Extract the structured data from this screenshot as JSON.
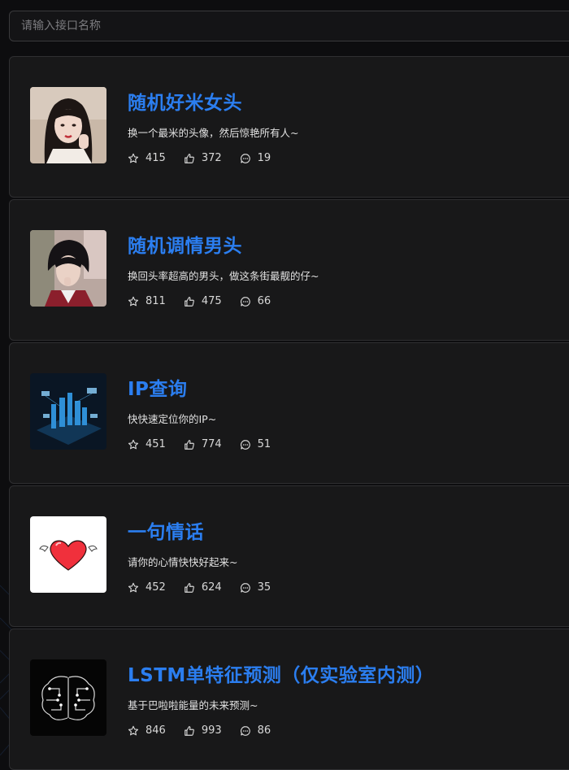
{
  "search": {
    "placeholder": "请输入接口名称"
  },
  "cards": [
    {
      "title": "随机好米女头",
      "description": "换一个最米的头像，然后惊艳所有人~",
      "stars": "415",
      "likes": "372",
      "comments": "19",
      "thumbnail": "girl-portrait"
    },
    {
      "title": "随机调情男头",
      "description": "换回头率超高的男头，做这条街最靓的仔~",
      "stars": "811",
      "likes": "475",
      "comments": "66",
      "thumbnail": "boy-portrait"
    },
    {
      "title": "IP查询",
      "description": "快快速定位你的IP~",
      "stars": "451",
      "likes": "774",
      "comments": "51",
      "thumbnail": "city-network"
    },
    {
      "title": "一句情话",
      "description": "请你的心情快快好起来~",
      "stars": "452",
      "likes": "624",
      "comments": "35",
      "thumbnail": "winged-heart"
    },
    {
      "title": "LSTM单特征预测（仅实验室内测）",
      "description": "基于巴啦啦能量的未来预测~",
      "stars": "846",
      "likes": "993",
      "comments": "86",
      "thumbnail": "circuit-brain"
    }
  ],
  "icons": {
    "star": "star-icon",
    "like": "thumbs-up-icon",
    "comment": "comment-icon"
  },
  "colors": {
    "accent": "#2b7ef0",
    "background": "#0d0d0f",
    "card": "#181819"
  }
}
